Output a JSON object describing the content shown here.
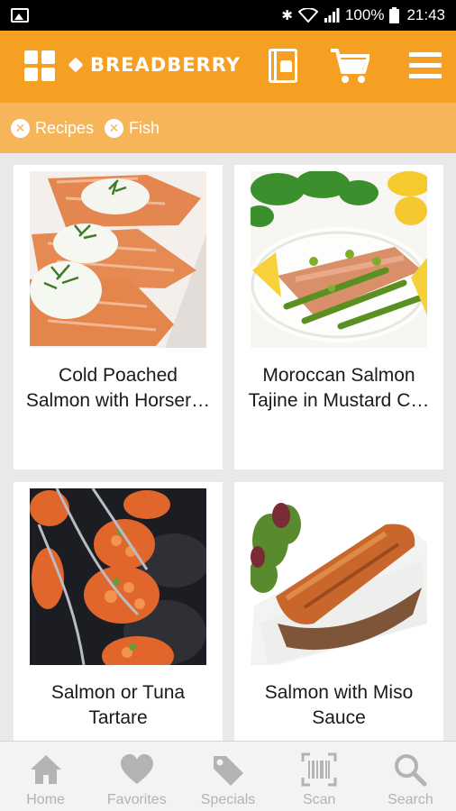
{
  "status_bar": {
    "battery": "100%",
    "time": "21:43",
    "icons": [
      "gallery-icon",
      "bluetooth-icon",
      "wifi-icon",
      "signal-icon",
      "battery-icon"
    ]
  },
  "app_bar": {
    "brand": "BREADBERRY",
    "icons": [
      "grid-icon",
      "recipe-book-icon",
      "cart-icon",
      "menu-icon"
    ],
    "accent_color": "#f5a023"
  },
  "filters": [
    {
      "label": "Recipes"
    },
    {
      "label": "Fish"
    }
  ],
  "recipes": [
    {
      "line1": "Cold Poached",
      "line2": "Salmon with Horser…"
    },
    {
      "line1": "Moroccan Salmon",
      "line2": "Tajine in Mustard C…"
    },
    {
      "line1": "Salmon or Tuna",
      "line2": "Tartare"
    },
    {
      "line1": "Salmon with Miso",
      "line2": "Sauce"
    }
  ],
  "bottom_nav": [
    {
      "label": "Home",
      "icon": "home-icon"
    },
    {
      "label": "Favorites",
      "icon": "heart-icon"
    },
    {
      "label": "Specials",
      "icon": "tag-icon"
    },
    {
      "label": "Scan",
      "icon": "barcode-scan-icon"
    },
    {
      "label": "Search",
      "icon": "search-icon"
    }
  ]
}
